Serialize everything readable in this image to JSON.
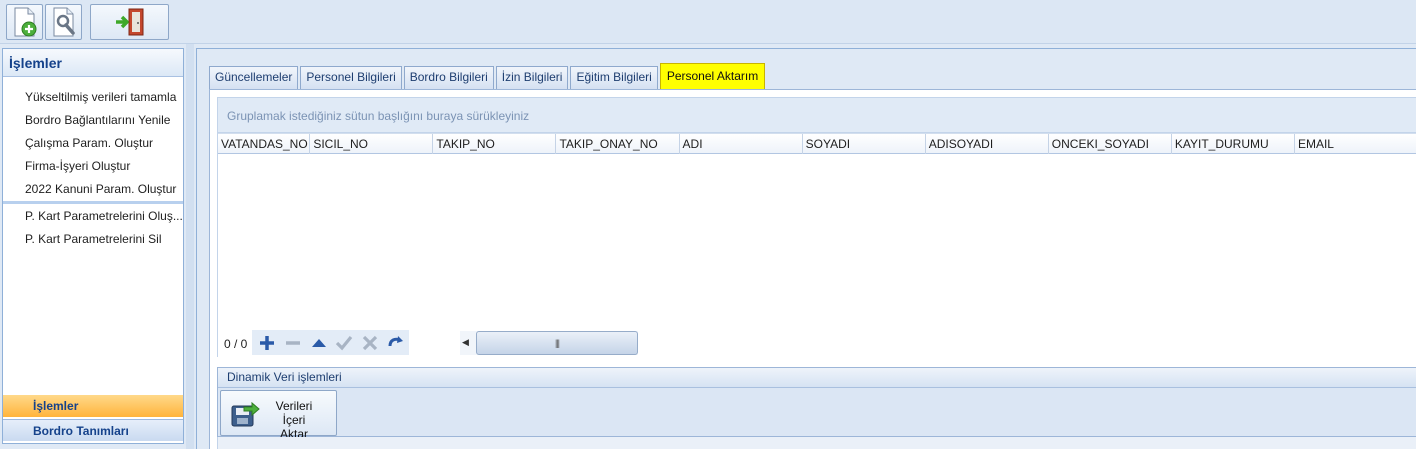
{
  "toolbar": {
    "buttons": [
      {
        "name": "new-document",
        "icon": "document-add-icon"
      },
      {
        "name": "settings",
        "icon": "document-wrench-icon"
      },
      {
        "name": "exit",
        "icon": "exit-door-icon"
      }
    ]
  },
  "sidebar": {
    "title": "İşlemler",
    "items": [
      {
        "label": "Yükseltilmiş verileri tamamla"
      },
      {
        "label": "Bordro Bağlantılarını Yenile"
      },
      {
        "label": "Çalışma Param. Oluştur"
      },
      {
        "label": "Firma-İşyeri Oluştur"
      },
      {
        "label": "2022 Kanuni Param. Oluştur"
      },
      {
        "label": "P. Kart Parametrelerini Oluş..."
      },
      {
        "label": "P. Kart Parametrelerini Sil"
      }
    ],
    "footer": [
      {
        "label": "İşlemler",
        "active": true
      },
      {
        "label": "Bordro Tanımları",
        "active": false
      }
    ]
  },
  "tabs": [
    {
      "label": "Güncellemeler"
    },
    {
      "label": "Personel Bilgileri"
    },
    {
      "label": "Bordro Bilgileri"
    },
    {
      "label": "İzin Bilgileri"
    },
    {
      "label": "Eğitim Bilgileri"
    },
    {
      "label": "Personel Aktarım",
      "active": true
    }
  ],
  "grid": {
    "group_hint": "Gruplamak istediğiniz sütun başlığını buraya sürükleyiniz",
    "columns": [
      "VATANDAS_NO",
      "SICIL_NO",
      "TAKIP_NO",
      "TAKIP_ONAY_NO",
      "ADI",
      "SOYADI",
      "ADISOYADI",
      "ONCEKI_SOYADI",
      "KAYIT_DURUMU",
      "EMAIL"
    ],
    "rows": [],
    "navigator": {
      "count": "0 / 0",
      "buttons": [
        "add-icon",
        "remove-icon",
        "up-icon",
        "check-icon",
        "cancel-icon",
        "refresh-icon"
      ]
    },
    "scroll_thumb": "|||"
  },
  "dynamic_panel": {
    "title": "Dinamik Veri işlemleri",
    "import_button": {
      "line1": "Verileri İçeri",
      "line2": "Aktar",
      "icon": "save-import-icon"
    }
  },
  "colors": {
    "active_tab": "#ffff00",
    "active_footer": "#ffb43c",
    "header_text": "#15428b"
  }
}
